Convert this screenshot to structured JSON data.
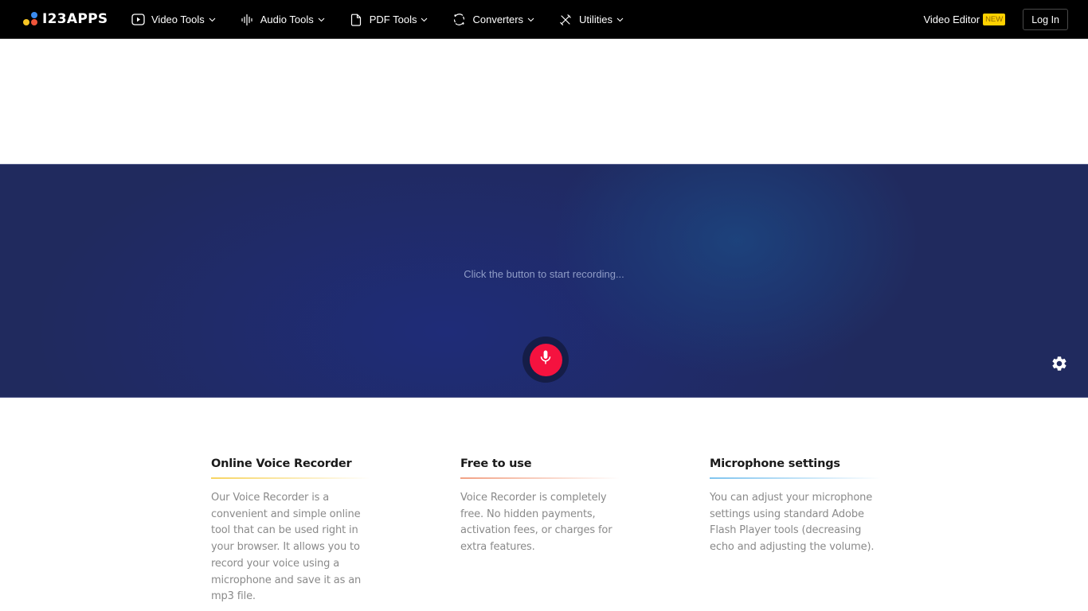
{
  "header": {
    "logo_text": "I23APPS",
    "nav": [
      {
        "label": "Video Tools",
        "icon": "play-icon"
      },
      {
        "label": "Audio Tools",
        "icon": "waveform-icon"
      },
      {
        "label": "PDF Tools",
        "icon": "document-icon"
      },
      {
        "label": "Converters",
        "icon": "convert-icon"
      },
      {
        "label": "Utilities",
        "icon": "tools-icon"
      }
    ],
    "video_editor_label": "Video Editor",
    "new_badge": "NEW",
    "login_label": "Log In"
  },
  "recorder": {
    "status_text": "Click the button to start recording...",
    "record_button_icon": "microphone-icon",
    "settings_icon": "gear-icon",
    "record_color": "#f5123f"
  },
  "info": [
    {
      "title": "Online Voice Recorder",
      "text": "Our Voice Recorder is a convenient and simple online tool that can be used right in your browser. It allows you to record your voice using a microphone and save it as an mp3 file.",
      "accent": "#f7d460"
    },
    {
      "title": "Free to use",
      "text": "Voice Recorder is completely free. No hidden payments, activation fees, or charges for extra features.",
      "accent": "#f2a184"
    },
    {
      "title": "Microphone settings",
      "text": "You can adjust your microphone settings using standard Adobe Flash Player tools (decreasing echo and adjusting the volume).",
      "accent": "#7fc4ef"
    }
  ]
}
